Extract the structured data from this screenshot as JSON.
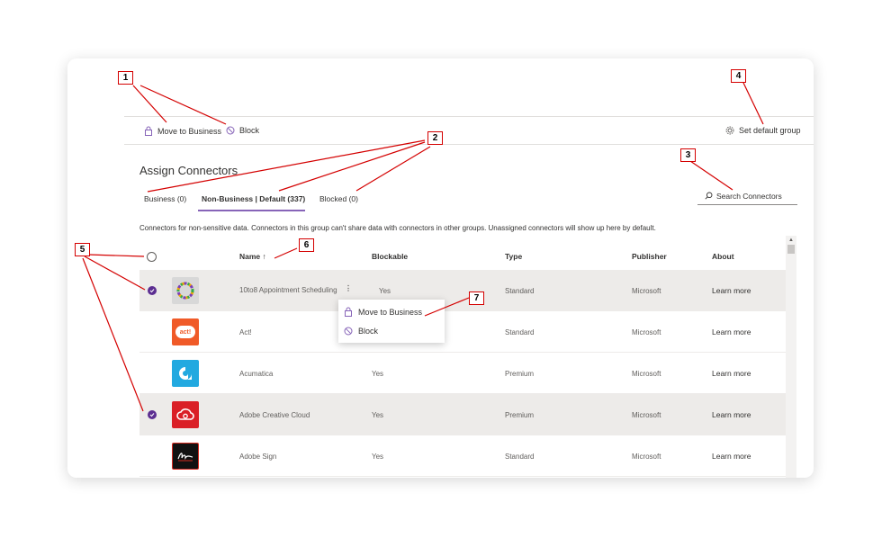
{
  "toolbar": {
    "move_to_business": "Move to Business",
    "block": "Block",
    "set_default_group": "Set default group"
  },
  "page": {
    "title": "Assign Connectors",
    "description": "Connectors for non-sensitive data. Connectors in this group can't share data with connectors in other groups. Unassigned connectors will show up here by default."
  },
  "tabs": [
    {
      "label": "Business (0)"
    },
    {
      "label": "Non-Business | Default (337)"
    },
    {
      "label": "Blocked (0)"
    }
  ],
  "search": {
    "placeholder": "Search Connectors"
  },
  "table": {
    "headers": {
      "name": "Name ↑",
      "blockable": "Blockable",
      "type": "Type",
      "publisher": "Publisher",
      "about": "About"
    },
    "rows": [
      {
        "name": "10to8 Appointment Scheduling",
        "blockable": "Yes",
        "type": "Standard",
        "publisher": "Microsoft",
        "about": "Learn more",
        "selected": true,
        "logo": "10to8-logo"
      },
      {
        "name": "Act!",
        "blockable": "",
        "type": "Standard",
        "publisher": "Microsoft",
        "about": "Learn more",
        "selected": false,
        "logo": "act-logo",
        "logo_text": "act!"
      },
      {
        "name": "Acumatica",
        "blockable": "Yes",
        "type": "Premium",
        "publisher": "Microsoft",
        "about": "Learn more",
        "selected": false,
        "logo": "acumatica-logo"
      },
      {
        "name": "Adobe Creative Cloud",
        "blockable": "Yes",
        "type": "Premium",
        "publisher": "Microsoft",
        "about": "Learn more",
        "selected": true,
        "logo": "adobe-creative-cloud-logo"
      },
      {
        "name": "Adobe Sign",
        "blockable": "Yes",
        "type": "Standard",
        "publisher": "Microsoft",
        "about": "Learn more",
        "selected": false,
        "logo": "adobe-sign-logo"
      }
    ]
  },
  "context_menu": {
    "items": [
      {
        "label": "Move to Business",
        "icon": "lock-icon"
      },
      {
        "label": "Block",
        "icon": "block-icon"
      }
    ]
  },
  "callouts": [
    "1",
    "2",
    "3",
    "4",
    "5",
    "6",
    "7"
  ],
  "colors": {
    "accent": "#8764b8",
    "check": "#5c2e91",
    "callout": "#d40000"
  }
}
